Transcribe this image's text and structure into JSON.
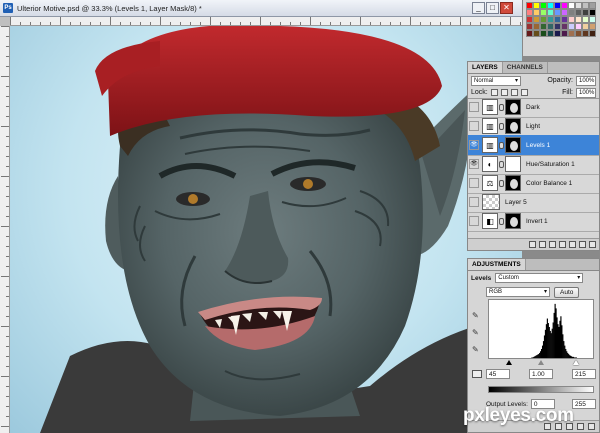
{
  "document": {
    "title": "Ulterior Motive.psd @ 33.3% (Levels 1, Layer Mask/8) *",
    "icon": "ps-app-icon",
    "buttons": {
      "minimize": "_",
      "maximize": "□",
      "close": "✕"
    }
  },
  "swatches": [
    "#ff0000",
    "#ffff00",
    "#00ff00",
    "#00ffff",
    "#0000ff",
    "#ff00ff",
    "#ffffff",
    "#e0e0e0",
    "#c0c0c0",
    "#a0a0a0",
    "#ff8080",
    "#ffcc66",
    "#99ff66",
    "#66ffcc",
    "#6699ff",
    "#cc66ff",
    "#808080",
    "#606060",
    "#404040",
    "#000000",
    "#cc3333",
    "#cc9933",
    "#669933",
    "#339999",
    "#336699",
    "#663399",
    "#ffcccc",
    "#ffe5cc",
    "#e5ffcc",
    "#ccfff0",
    "#993333",
    "#996633",
    "#336633",
    "#336666",
    "#333366",
    "#663366",
    "#ccccff",
    "#ffccff",
    "#f0d0a0",
    "#d0a070",
    "#661a1a",
    "#664d1a",
    "#1a4d1a",
    "#1a4d4d",
    "#1a1a4d",
    "#4d1a4d",
    "#a07050",
    "#805030",
    "#603820",
    "#402010"
  ],
  "layers_panel": {
    "tabs": [
      "LAYERS",
      "CHANNELS"
    ],
    "blend_mode": "Normal",
    "opacity_label": "Opacity:",
    "opacity": "100%",
    "lock_label": "Lock:",
    "fill_label": "Fill:",
    "fill": "100%",
    "layers": [
      {
        "name": "Dark",
        "visible": false,
        "kind": "levels",
        "mask": "dark"
      },
      {
        "name": "Light",
        "visible": false,
        "kind": "levels",
        "mask": "dark"
      },
      {
        "name": "Levels 1",
        "visible": true,
        "kind": "levels",
        "mask": "dark",
        "selected": true
      },
      {
        "name": "Hue/Saturation 1",
        "visible": true,
        "kind": "hue-saturation",
        "mask": "white"
      },
      {
        "name": "Color Balance 1",
        "visible": false,
        "kind": "color-balance",
        "mask": "dark"
      },
      {
        "name": "Layer 5",
        "visible": false,
        "kind": "pixel",
        "mask": ""
      },
      {
        "name": "Invert 1",
        "visible": false,
        "kind": "invert",
        "mask": "dark"
      }
    ]
  },
  "adjustments_panel": {
    "tab": "ADJUSTMENTS",
    "type_label": "Levels",
    "preset": "Custom",
    "channel": "RGB",
    "auto_label": "Auto",
    "input_black": "45",
    "input_gamma": "1.00",
    "input_white": "215",
    "output_label": "Output Levels:",
    "output_black": "0",
    "output_white": "255",
    "histogram": [
      0,
      0,
      0,
      0,
      0,
      0,
      0,
      0,
      0,
      0,
      0,
      0,
      0,
      0,
      0,
      0,
      0,
      0,
      0,
      0,
      0,
      0,
      0,
      0,
      0,
      0,
      0,
      0,
      0,
      0,
      0,
      0,
      0,
      0,
      0,
      0,
      0,
      0,
      0,
      0,
      0,
      0,
      0,
      1,
      1,
      2,
      3,
      4,
      5,
      6,
      7,
      9,
      12,
      16,
      22,
      30,
      40,
      50,
      60,
      70,
      62,
      55,
      48,
      44,
      52,
      63,
      80,
      96,
      88,
      72,
      60,
      55,
      66,
      74,
      58,
      42,
      30,
      22,
      16,
      12,
      9,
      7,
      5,
      4,
      3,
      2,
      2,
      1,
      1,
      1,
      0,
      0,
      0,
      0,
      0,
      0,
      0,
      0,
      0,
      0,
      0,
      0,
      0,
      0,
      0,
      0
    ]
  },
  "watermark": "pxleyes.com"
}
